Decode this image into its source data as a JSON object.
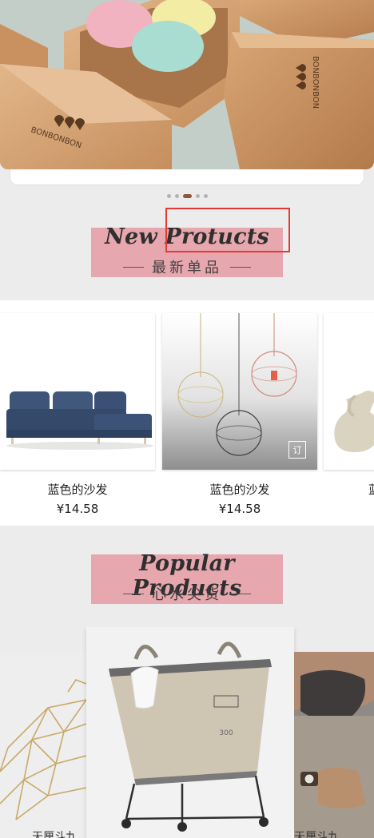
{
  "hero": {
    "brand_text": "BONBONBON",
    "active_slide": 3,
    "slide_count": 5
  },
  "sections": {
    "new": {
      "title_en": "New Protucts",
      "title_zh": "最新单品"
    },
    "popular": {
      "title_en": "Popular Products",
      "title_zh": "心水尖货"
    }
  },
  "new_products": [
    {
      "name": "蓝色的沙发",
      "price": "¥14.58"
    },
    {
      "name": "蓝色的沙发",
      "price": "¥14.58",
      "badge": "订"
    },
    {
      "name": "蓝"
    }
  ],
  "popular_products": {
    "left_label": "天厘斗九",
    "right_label": "天厘斗九",
    "center_tag": "300"
  },
  "colors": {
    "accent_pink": "#e7a7ae",
    "highlight_red": "#e53935",
    "sofa_blue": "#3e5478"
  }
}
